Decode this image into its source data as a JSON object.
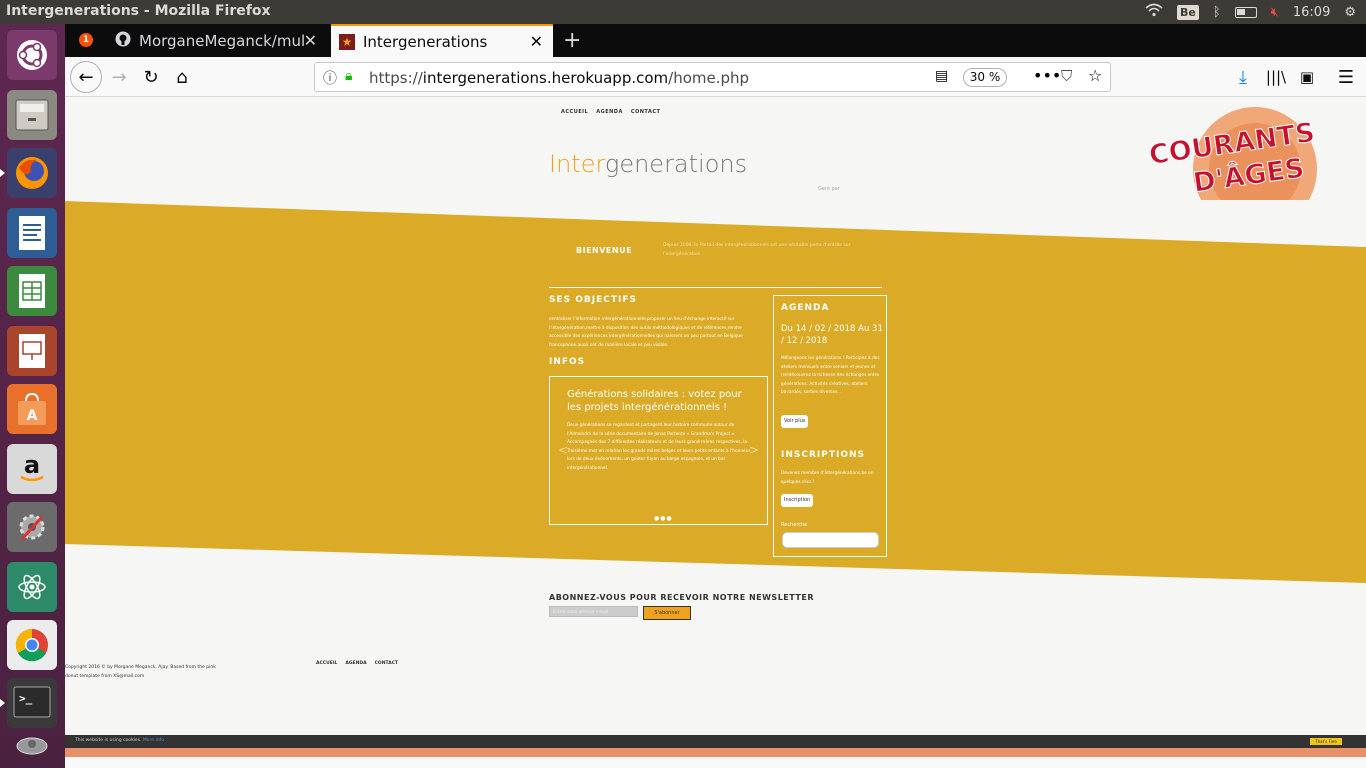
{
  "window": {
    "title": "Intergenerations - Mozilla Firefox"
  },
  "tray": {
    "kbd": "Be",
    "clock": "16:09"
  },
  "tabs": [
    {
      "label": "MorganeMeganck/mult",
      "badge": "1"
    },
    {
      "label": "Intergenerations"
    }
  ],
  "urlbar": {
    "scheme": "https://",
    "host": "intergenerations.herokuapp.com",
    "path": "/home.php",
    "zoom": "30 %"
  },
  "site": {
    "nav": [
      "ACCUEIL",
      "AGENDA",
      "CONTACT"
    ],
    "title_prefix": "Inter",
    "title_suffix": "generations",
    "tagline": "Geré par",
    "logo_text": "COURANTS D'ÂGES",
    "welcome_label": "BIENVENUE",
    "welcome_text": "Depuis 2008, le Portail des intergénérationnels est une véritable porte d'entrée sur l'intergénération.",
    "objectifs_heading": "SES OBJECTIFS",
    "objectifs_text": "centraliser l'information intergénérationnelle,proposer un lieu d'échange interactif sur l'intergénération,mettre à disposition des outils méthodologiques et de références,rendre accessible des expériences intergénérationnelles qui naissent un peu partout en Belgique francophone aussi ont de manière locale et peu visible.",
    "infos_heading": "INFOS",
    "carousel_title": "Générations solidaires : votez pour les projets intergénérationnels !",
    "carousel_text": "Deux générations se regardent et partagent leur histoire commune autour de l'Almoindre de la série documentaire de Jonas Portente « Grandma's Project ». Accompagnés des 7 différentes réalisateurs et de leurs grand-mères respectives, la Troisième met en relation les grands mères belges et leurs petits-enfants à l'honneur lors de deux événements, un goûter fuyon au barge espagnole, et un bal intergénérationnel.",
    "carousel_dots": "●●●",
    "agenda_heading": "AGENDA",
    "agenda_date": "Du 14 / 02 / 2018 Au 31 / 12 / 2018",
    "agenda_text": "Mélangeons les générations ! Participez à des ateliers mensuels entre seniors et jeunes et (re)découvrez la richesse des échanges entre générations. Activités créatives, ateliers bavardés, sorties diverses…",
    "agenda_button": "Voir plus",
    "inscriptions_heading": "INSCRIPTIONS",
    "inscriptions_text": "Devenez membre d'Intergénérations.be en quelques clics !",
    "inscription_button": "Inscription",
    "search_label": "Recherche",
    "newsletter_heading": "ABONNEZ-VOUS POUR RECEVOIR NOTRE NEWSLETTER",
    "newsletter_placeholder": "Entrez votre adresse e-mail",
    "newsletter_button": "S'abonner",
    "copyright": "Copyright 2016 © by Morgane Meganck, Ajay. Based from the pink donut template from XS@mail.com",
    "footer_nav": [
      "ACCUEIL",
      "AGENDA",
      "CONTACT"
    ],
    "cookie_text": "This website is using cookies.",
    "cookie_link": "More info",
    "cookie_ok": "That's Fine"
  }
}
